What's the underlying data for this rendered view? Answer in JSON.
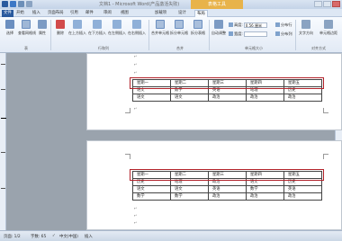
{
  "titlebar": {
    "document_title": "文档1 - Microsoft Word(产品激活失败)",
    "context_tab": "表格工具"
  },
  "ribbon_tabs": [
    {
      "label": "文件"
    },
    {
      "label": "开始"
    },
    {
      "label": "插入"
    },
    {
      "label": "页面布局"
    },
    {
      "label": "引用"
    },
    {
      "label": "邮件"
    },
    {
      "label": "审阅"
    },
    {
      "label": "视图"
    },
    {
      "label": "加载项"
    },
    {
      "label": "设计"
    },
    {
      "label": "布局"
    }
  ],
  "ribbon": {
    "buttons": [
      {
        "label": "选择"
      },
      {
        "label": "查看网格线"
      },
      {
        "label": "属性"
      },
      {
        "label": "删除"
      },
      {
        "label": "在上方插入"
      },
      {
        "label": "在下方插入"
      },
      {
        "label": "在左侧插入"
      },
      {
        "label": "在右侧插入"
      },
      {
        "label": "合并单元格"
      },
      {
        "label": "拆分单元格"
      },
      {
        "label": "拆分表格"
      },
      {
        "label": "自动调整"
      },
      {
        "label": "文字方向"
      },
      {
        "label": "单元格边距"
      }
    ],
    "height_label": "高度:",
    "height_value": "0.56 厘米",
    "width_label": "宽度:",
    "groups": {
      "table": "表",
      "rows_cols": "行和列",
      "merge": "合并",
      "cell_size": "单元格大小",
      "alignment": "对齐方式"
    },
    "dist_rows": "分布行",
    "dist_cols": "分布列"
  },
  "page1_table": {
    "rows": [
      [
        "星期一",
        "星期二",
        "星期三",
        "星期四",
        "星期五"
      ],
      [
        "语文",
        "数学",
        "英语",
        "地理",
        "历史"
      ],
      [
        "语文",
        "语文",
        "政治",
        "政治",
        "政治"
      ]
    ]
  },
  "page2_table": {
    "rows": [
      [
        "星期一",
        "星期二",
        "星期三",
        "星期四",
        "星期五"
      ],
      [
        "历史",
        "地理",
        "政治",
        "语文",
        "历史"
      ],
      [
        "语文",
        "语文",
        "英语",
        "数学",
        "英语"
      ],
      [
        "数学",
        "数学",
        "政治",
        "政治",
        "政治"
      ]
    ]
  },
  "statusbar": {
    "page": "页面: 1/2",
    "words": "字数: 65",
    "language": "中文(中国)",
    "mode": "插入"
  },
  "colors": {
    "highlight": "#b2222a",
    "context_tab": "#e8b34a",
    "file_tab": "#2a5a9e"
  }
}
